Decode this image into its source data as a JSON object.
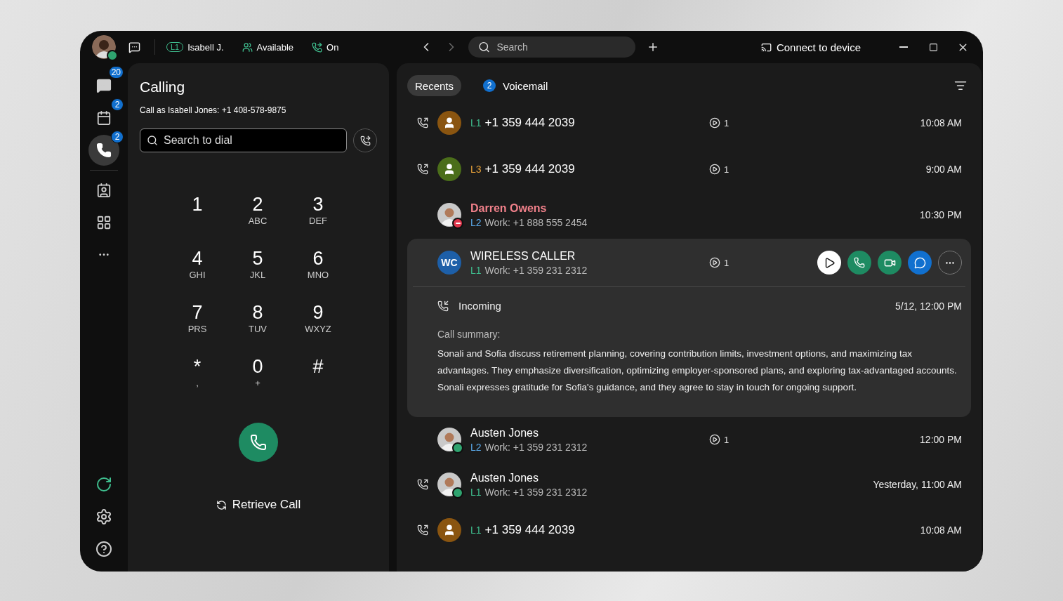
{
  "title_bar": {
    "status_items": [
      {
        "kind": "line",
        "badge": "L1",
        "label": "Isabell J."
      },
      {
        "kind": "presence",
        "label": "Available"
      },
      {
        "kind": "forward",
        "label": "On"
      }
    ],
    "search_placeholder": "Search",
    "connect": "Connect to device"
  },
  "rail": {
    "items": [
      {
        "kind": "chat",
        "badge": "20",
        "selected": false
      },
      {
        "kind": "calendar",
        "badge": "2",
        "selected": false
      },
      {
        "kind": "phone",
        "badge": "2",
        "selected": true
      },
      {
        "kind": "contacts",
        "selected": false
      },
      {
        "kind": "apps",
        "selected": false
      },
      {
        "kind": "more",
        "selected": false
      }
    ],
    "bottom": [
      {
        "kind": "refresh"
      },
      {
        "kind": "settings"
      },
      {
        "kind": "help"
      }
    ]
  },
  "calling": {
    "title": "Calling",
    "subtitle": "Call as Isabell Jones: +1 408-578-9875",
    "search_placeholder": "Search to dial",
    "keypad": [
      {
        "digit": "1"
      },
      {
        "digit": "2",
        "letters": "ABC"
      },
      {
        "digit": "3",
        "letters": "DEF"
      },
      {
        "digit": "4",
        "letters": "GHI"
      },
      {
        "digit": "5",
        "letters": "JKL"
      },
      {
        "digit": "6",
        "letters": "MNO"
      },
      {
        "digit": "7",
        "letters": "PRS"
      },
      {
        "digit": "8",
        "letters": "TUV"
      },
      {
        "digit": "9",
        "letters": "WXYZ"
      },
      {
        "digit": "*",
        "letters": ","
      },
      {
        "digit": "0",
        "letters": "+"
      },
      {
        "digit": "#"
      }
    ],
    "retrieve": "Retrieve Call"
  },
  "recents": {
    "tabs": [
      {
        "label": "Recents",
        "selected": true
      },
      {
        "label": "Voicemail",
        "badge": "2",
        "selected": false
      }
    ],
    "rows": [
      {
        "outgoing": true,
        "avatar": {
          "kind": "placeholder",
          "color": "#8a5510"
        },
        "line": {
          "label": "L1",
          "color": "#3fbf8f"
        },
        "name": "+1 359 444 2039",
        "missed": false,
        "voicemail": "1",
        "time": "10:08 AM",
        "expanded": false
      },
      {
        "outgoing": true,
        "avatar": {
          "kind": "placeholder",
          "color": "#4b6e1a"
        },
        "line": {
          "label": "L3",
          "color": "#e8a23a"
        },
        "name": "+1 359 444 2039",
        "missed": false,
        "voicemail": "1",
        "time": "9:00 AM",
        "expanded": false
      },
      {
        "outgoing": false,
        "presence": {
          "kind": "dnd",
          "color": "#e0364c"
        },
        "line": {
          "label": "L2",
          "color": "#5aa9ea"
        },
        "name": "Darren Owens",
        "missed": true,
        "detail": "Work: +1 888 555 2454",
        "time": "10:30 PM",
        "expanded": false
      },
      {
        "outgoing": false,
        "avatar": {
          "kind": "initials",
          "text": "WC",
          "color": "#1d5fa8"
        },
        "line": {
          "label": "L1",
          "color": "#3fbf8f"
        },
        "name": "WIRELESS CALLER",
        "missed": false,
        "detail": "Work: +1 359 231 2312",
        "voicemail": "1",
        "expanded": true,
        "details": {
          "direction_label": "Incoming",
          "date": "5/12, 12:00 PM",
          "summary_label": "Call summary:",
          "summary": "Sonali and Sofia discuss retirement planning, covering contribution limits, investment options, and maximizing tax advantages. They emphasize diversification, optimizing employer-sponsored plans, and exploring tax-advantaged accounts. Sonali expresses gratitude for Sofia's guidance, and they agree to stay in touch for ongoing support."
        }
      },
      {
        "outgoing": false,
        "presence": {
          "kind": "available",
          "color": "#2fa36f"
        },
        "line": {
          "label": "L2",
          "color": "#5aa9ea"
        },
        "name": "Austen Jones",
        "missed": false,
        "detail": "Work: +1 359 231 2312",
        "voicemail": "1",
        "time": "12:00 PM",
        "expanded": false
      },
      {
        "outgoing": true,
        "presence": {
          "kind": "available",
          "color": "#2fa36f"
        },
        "line": {
          "label": "L1",
          "color": "#3fbf8f"
        },
        "name": "Austen Jones",
        "missed": false,
        "detail": "Work: +1 359 231 2312",
        "time": "Yesterday, 11:00 AM",
        "expanded": false
      },
      {
        "outgoing": true,
        "avatar": {
          "kind": "placeholder",
          "color": "#8a5510"
        },
        "line": {
          "label": "L1",
          "color": "#3fbf8f"
        },
        "name": "+1 359 444 2039",
        "missed": false,
        "time": "10:08 AM",
        "expanded": false
      }
    ]
  }
}
